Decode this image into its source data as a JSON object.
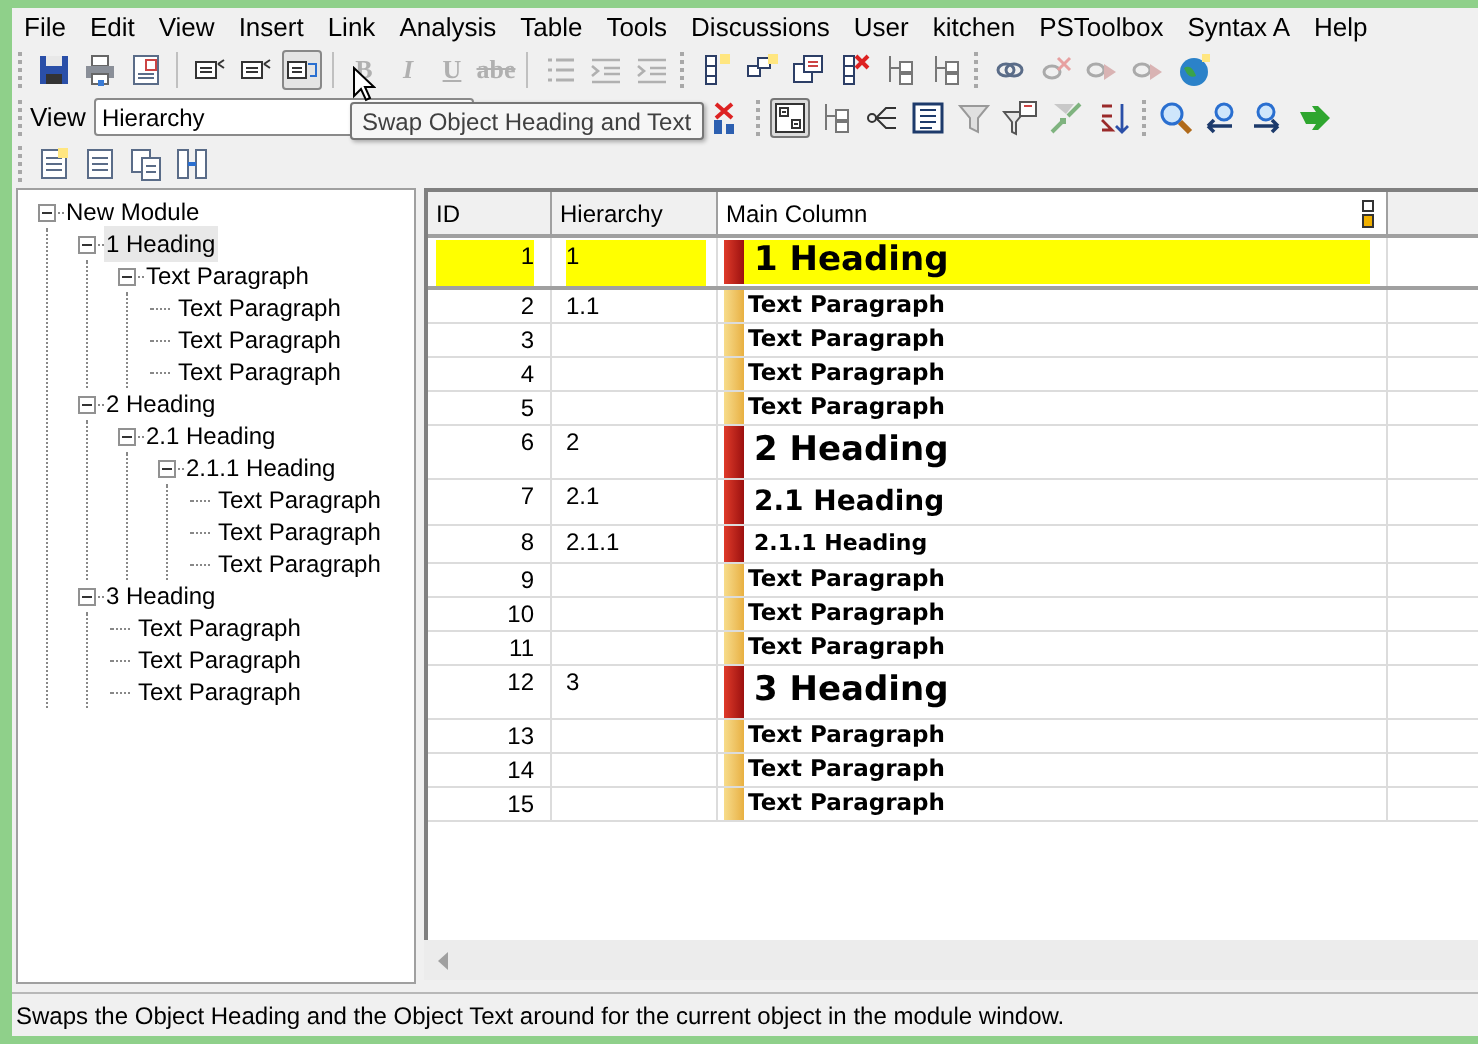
{
  "menu": [
    "File",
    "Edit",
    "View",
    "Insert",
    "Link",
    "Analysis",
    "Table",
    "Tools",
    "Discussions",
    "User",
    "kitchen",
    "PSToolbox",
    "Syntax A",
    "Help"
  ],
  "format_buttons": [
    {
      "label": "B",
      "disabled": true
    },
    {
      "label": "I",
      "disabled": true
    },
    {
      "label": "U",
      "disabled": true
    },
    {
      "label": "abe",
      "disabled": true
    }
  ],
  "view_bar": {
    "label": "View",
    "value": "Hierarchy"
  },
  "tooltip": "Swap Object Heading and Text",
  "tree": [
    {
      "label": "New Module",
      "expanded": true,
      "selected": false,
      "children": [
        {
          "label": "1 Heading",
          "expanded": true,
          "selected": true,
          "children": [
            {
              "label": "Text Paragraph",
              "expanded": true,
              "selected": false,
              "children": [
                {
                  "label": "Text Paragraph",
                  "selected": false
                },
                {
                  "label": "Text Paragraph",
                  "selected": false
                },
                {
                  "label": "Text Paragraph",
                  "selected": false
                }
              ]
            }
          ]
        },
        {
          "label": "2 Heading",
          "expanded": true,
          "selected": false,
          "children": [
            {
              "label": "2.1 Heading",
              "expanded": true,
              "selected": false,
              "children": [
                {
                  "label": "2.1.1 Heading",
                  "expanded": true,
                  "selected": false,
                  "children": [
                    {
                      "label": "Text Paragraph",
                      "selected": false
                    },
                    {
                      "label": "Text Paragraph",
                      "selected": false
                    },
                    {
                      "label": "Text Paragraph",
                      "selected": false
                    }
                  ]
                }
              ]
            }
          ]
        },
        {
          "label": "3 Heading",
          "expanded": true,
          "selected": false,
          "children": [
            {
              "label": "Text Paragraph",
              "selected": false
            },
            {
              "label": "Text Paragraph",
              "selected": false
            },
            {
              "label": "Text Paragraph",
              "selected": false
            }
          ]
        }
      ]
    }
  ],
  "table": {
    "columns": [
      "ID",
      "Hierarchy",
      "Main Column"
    ],
    "rows": [
      {
        "id": "1",
        "hierarchy": "1",
        "text": "1 Heading",
        "kind": "heading1",
        "selected": true
      },
      {
        "id": "2",
        "hierarchy": "1.1",
        "text": "Text Paragraph",
        "kind": "paragraph",
        "selected": false
      },
      {
        "id": "3",
        "text": "Text Paragraph",
        "kind": "paragraph",
        "selected": false
      },
      {
        "id": "4",
        "text": "Text Paragraph",
        "kind": "paragraph",
        "selected": false
      },
      {
        "id": "5",
        "text": "Text Paragraph",
        "kind": "paragraph",
        "selected": false
      },
      {
        "id": "6",
        "hierarchy": "2",
        "text": "2 Heading",
        "kind": "heading1",
        "selected": false
      },
      {
        "id": "7",
        "hierarchy": "2.1",
        "text": "2.1 Heading",
        "kind": "heading2",
        "selected": false
      },
      {
        "id": "8",
        "hierarchy": "2.1.1",
        "text": "2.1.1 Heading",
        "kind": "heading3",
        "selected": false
      },
      {
        "id": "9",
        "text": "Text Paragraph",
        "kind": "paragraph",
        "selected": false
      },
      {
        "id": "10",
        "text": "Text Paragraph",
        "kind": "paragraph",
        "selected": false
      },
      {
        "id": "11",
        "text": "Text Paragraph",
        "kind": "paragraph",
        "selected": false
      },
      {
        "id": "12",
        "hierarchy": "3",
        "text": "3 Heading",
        "kind": "heading1",
        "selected": false
      },
      {
        "id": "13",
        "text": "Text Paragraph",
        "kind": "paragraph",
        "selected": false
      },
      {
        "id": "14",
        "text": "Text Paragraph",
        "kind": "paragraph",
        "selected": false
      },
      {
        "id": "15",
        "text": "Text Paragraph",
        "kind": "paragraph",
        "selected": false
      }
    ]
  },
  "status_bar": "Swaps the Object Heading and the Object Text around for the current object in the module window."
}
